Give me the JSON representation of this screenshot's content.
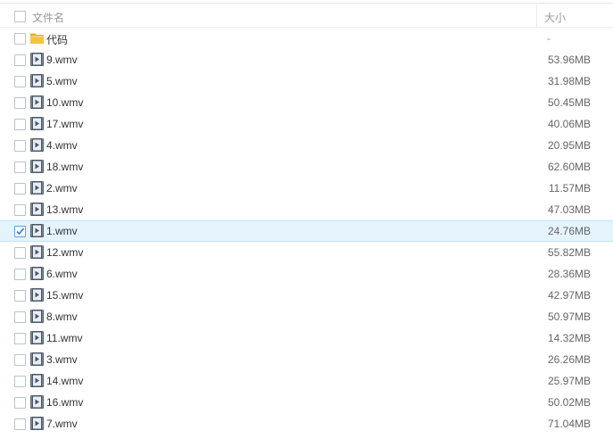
{
  "header": {
    "name_label": "文件名",
    "size_label": "大小"
  },
  "files": [
    {
      "name": "代码",
      "size": "-",
      "type": "folder",
      "checked": false
    },
    {
      "name": "9.wmv",
      "size": "53.96MB",
      "type": "video",
      "checked": false
    },
    {
      "name": "5.wmv",
      "size": "31.98MB",
      "type": "video",
      "checked": false
    },
    {
      "name": "10.wmv",
      "size": "50.45MB",
      "type": "video",
      "checked": false
    },
    {
      "name": "17.wmv",
      "size": "40.06MB",
      "type": "video",
      "checked": false
    },
    {
      "name": "4.wmv",
      "size": "20.95MB",
      "type": "video",
      "checked": false
    },
    {
      "name": "18.wmv",
      "size": "62.60MB",
      "type": "video",
      "checked": false
    },
    {
      "name": "2.wmv",
      "size": "11.57MB",
      "type": "video",
      "checked": false
    },
    {
      "name": "13.wmv",
      "size": "47.03MB",
      "type": "video",
      "checked": false
    },
    {
      "name": "1.wmv",
      "size": "24.76MB",
      "type": "video",
      "checked": true
    },
    {
      "name": "12.wmv",
      "size": "55.82MB",
      "type": "video",
      "checked": false
    },
    {
      "name": "6.wmv",
      "size": "28.36MB",
      "type": "video",
      "checked": false
    },
    {
      "name": "15.wmv",
      "size": "42.97MB",
      "type": "video",
      "checked": false
    },
    {
      "name": "8.wmv",
      "size": "50.97MB",
      "type": "video",
      "checked": false
    },
    {
      "name": "11.wmv",
      "size": "14.32MB",
      "type": "video",
      "checked": false
    },
    {
      "name": "3.wmv",
      "size": "26.26MB",
      "type": "video",
      "checked": false
    },
    {
      "name": "14.wmv",
      "size": "25.97MB",
      "type": "video",
      "checked": false
    },
    {
      "name": "16.wmv",
      "size": "50.02MB",
      "type": "video",
      "checked": false
    },
    {
      "name": "7.wmv",
      "size": "71.04MB",
      "type": "video",
      "checked": false
    }
  ],
  "icons": {
    "folder": "folder-icon",
    "video": "video-file-icon",
    "checkbox_checked": "checkmark-icon"
  },
  "colors": {
    "selected_row_bg": "#e5f3fc",
    "selected_row_border": "#c2e2f5",
    "folder": "#f5c242",
    "video_icon": "#4a5866",
    "checkmark": "#2b7fd1"
  }
}
